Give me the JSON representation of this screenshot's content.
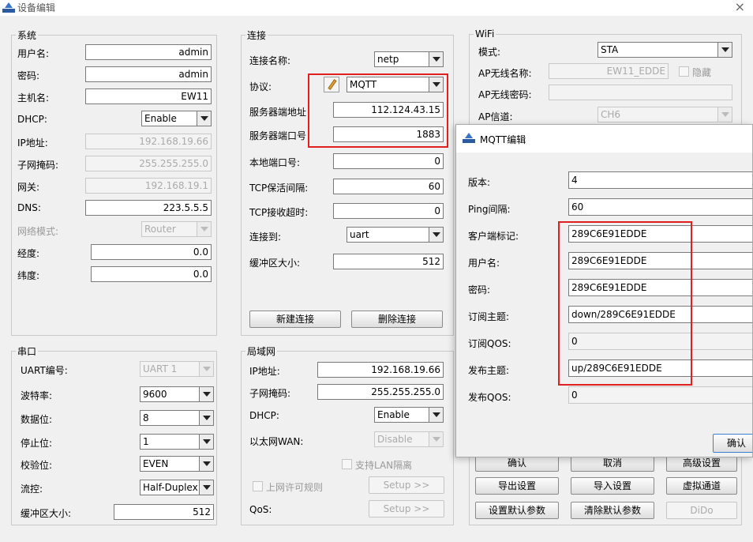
{
  "window": {
    "title": "设备编辑",
    "close": "×"
  },
  "system": {
    "legend": "系统",
    "username_label": "用户名:",
    "username": "admin",
    "password_label": "密码:",
    "password": "admin",
    "hostname_label": "主机名:",
    "hostname": "EW11",
    "dhcp_label": "DHCP:",
    "dhcp": "Enable",
    "ip_label": "IP地址:",
    "ip": "192.168.19.66",
    "mask_label": "子网掩码:",
    "mask": "255.255.255.0",
    "gateway_label": "网关:",
    "gateway": "192.168.19.1",
    "dns_label": "DNS:",
    "dns": "223.5.5.5",
    "netmode_label": "网络模式:",
    "netmode": "Router",
    "longitude_label": "经度:",
    "longitude": "0.0",
    "latitude_label": "纬度:",
    "latitude": "0.0"
  },
  "connection": {
    "legend": "连接",
    "name_label": "连接名称:",
    "name": "netp",
    "protocol_label": "协议:",
    "protocol": "MQTT",
    "server_addr_label": "服务器端地址",
    "server_addr": "112.124.43.15",
    "server_port_label": "服务器端口号",
    "server_port": "1883",
    "local_port_label": "本地端口号:",
    "local_port": "0",
    "keepalive_label": "TCP保活间隔:",
    "keepalive": "60",
    "recv_timeout_label": "TCP接收超时:",
    "recv_timeout": "0",
    "connect_to_label": "连接到:",
    "connect_to": "uart",
    "buffer_label": "缓冲区大小:",
    "buffer": "512",
    "new_button": "新建连接",
    "delete_button": "删除连接"
  },
  "wifi": {
    "legend": "WiFi",
    "mode_label": "模式:",
    "mode": "STA",
    "ap_ssid_label": "AP无线名称:",
    "ap_ssid": "EW11_EDDE",
    "hide_label": "隐藏",
    "ap_pwd_label": "AP无线密码:",
    "ap_pwd": "",
    "ap_channel_label": "AP信道:",
    "ap_channel": "CH6"
  },
  "serial": {
    "legend": "串口",
    "uart_label": "UART编号:",
    "uart": "UART 1",
    "baud_label": "波特率:",
    "baud": "9600",
    "databits_label": "数据位:",
    "databits": "8",
    "stopbits_label": "停止位:",
    "stopbits": "1",
    "parity_label": "校验位:",
    "parity": "EVEN",
    "flow_label": "流控:",
    "flow": "Half-Duplex",
    "buffer_label": "缓冲区大小:",
    "buffer": "512"
  },
  "lan": {
    "legend": "局域网",
    "ip_label": "IP地址:",
    "ip": "192.168.19.66",
    "mask_label": "子网掩码:",
    "mask": "255.255.255.0",
    "dhcp_label": "DHCP:",
    "dhcp": "Enable",
    "wan_label": "以太网WAN:",
    "wan": "Disable",
    "isolation_label": "支持LAN隔离",
    "rules_label": "上网许可规则",
    "setup_button": "Setup >>",
    "qos_label": "QoS:",
    "qos_setup_button": "Setup >>"
  },
  "actions": {
    "confirm": "确认",
    "cancel": "取消",
    "advanced": "高级设置",
    "export": "导出设置",
    "import": "导入设置",
    "virtual": "虚拟通道",
    "set_default": "设置默认参数",
    "clear_default": "清除默认参数",
    "dido": "DiDo"
  },
  "mqtt": {
    "title": "MQTT编辑",
    "version_label": "版本:",
    "version": "4",
    "ping_label": "Ping间隔:",
    "ping": "60",
    "client_id_label": "客户端标记:",
    "client_id": "289C6E91EDDE",
    "username_label": "用户名:",
    "username": "289C6E91EDDE",
    "password_label": "密码:",
    "password": "289C6E91EDDE",
    "sub_topic_label": "订阅主题:",
    "sub_topic": "down/289C6E91EDDE",
    "sub_qos_label": "订阅QOS:",
    "sub_qos": "0",
    "pub_topic_label": "发布主题:",
    "pub_topic": "up/289C6E91EDDE",
    "pub_qos_label": "发布QOS:",
    "pub_qos": "0",
    "confirm_button": "确认"
  },
  "colors": {
    "highlight_box": "#e02020"
  },
  "icons": {
    "app": "app-logo-icon",
    "close": "close-icon",
    "protocol_edit": "pencil-edit-icon"
  }
}
